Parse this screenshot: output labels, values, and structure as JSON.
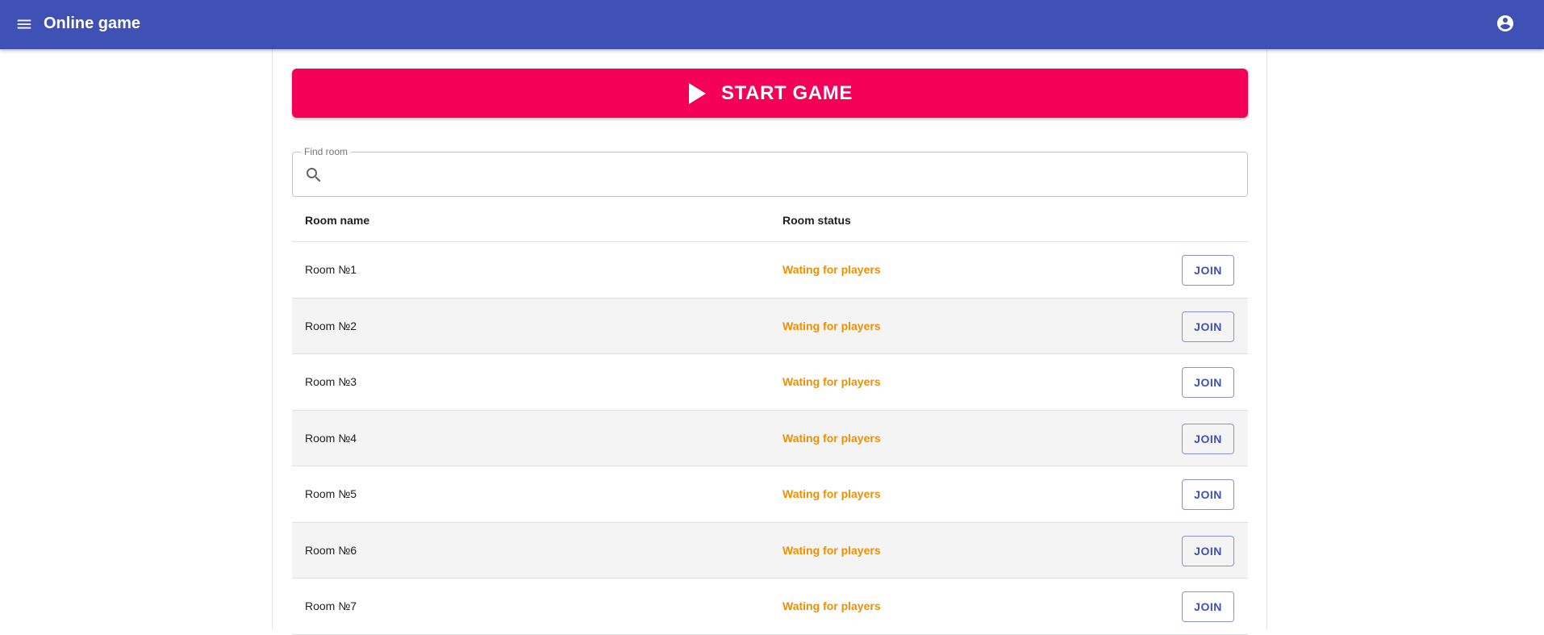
{
  "appbar": {
    "title": "Online game",
    "menu_icon": "menu-icon",
    "account_icon": "account-circle-icon",
    "color": "#3f51b5"
  },
  "start_game": {
    "label": "START GAME",
    "icon": "play-icon",
    "color": "#f50057"
  },
  "search": {
    "label": "Find room",
    "value": "",
    "placeholder": "",
    "icon": "search-icon"
  },
  "table": {
    "headers": {
      "name": "Room name",
      "status": "Room status"
    },
    "status_color": "#ef8f00",
    "rows": [
      {
        "name": "Room №1",
        "status": "Wating for players",
        "action": "JOIN"
      },
      {
        "name": "Room №2",
        "status": "Wating for players",
        "action": "JOIN"
      },
      {
        "name": "Room №3",
        "status": "Wating for players",
        "action": "JOIN"
      },
      {
        "name": "Room №4",
        "status": "Wating for players",
        "action": "JOIN"
      },
      {
        "name": "Room №5",
        "status": "Wating for players",
        "action": "JOIN"
      },
      {
        "name": "Room №6",
        "status": "Wating for players",
        "action": "JOIN"
      },
      {
        "name": "Room №7",
        "status": "Wating for players",
        "action": "JOIN"
      }
    ]
  }
}
